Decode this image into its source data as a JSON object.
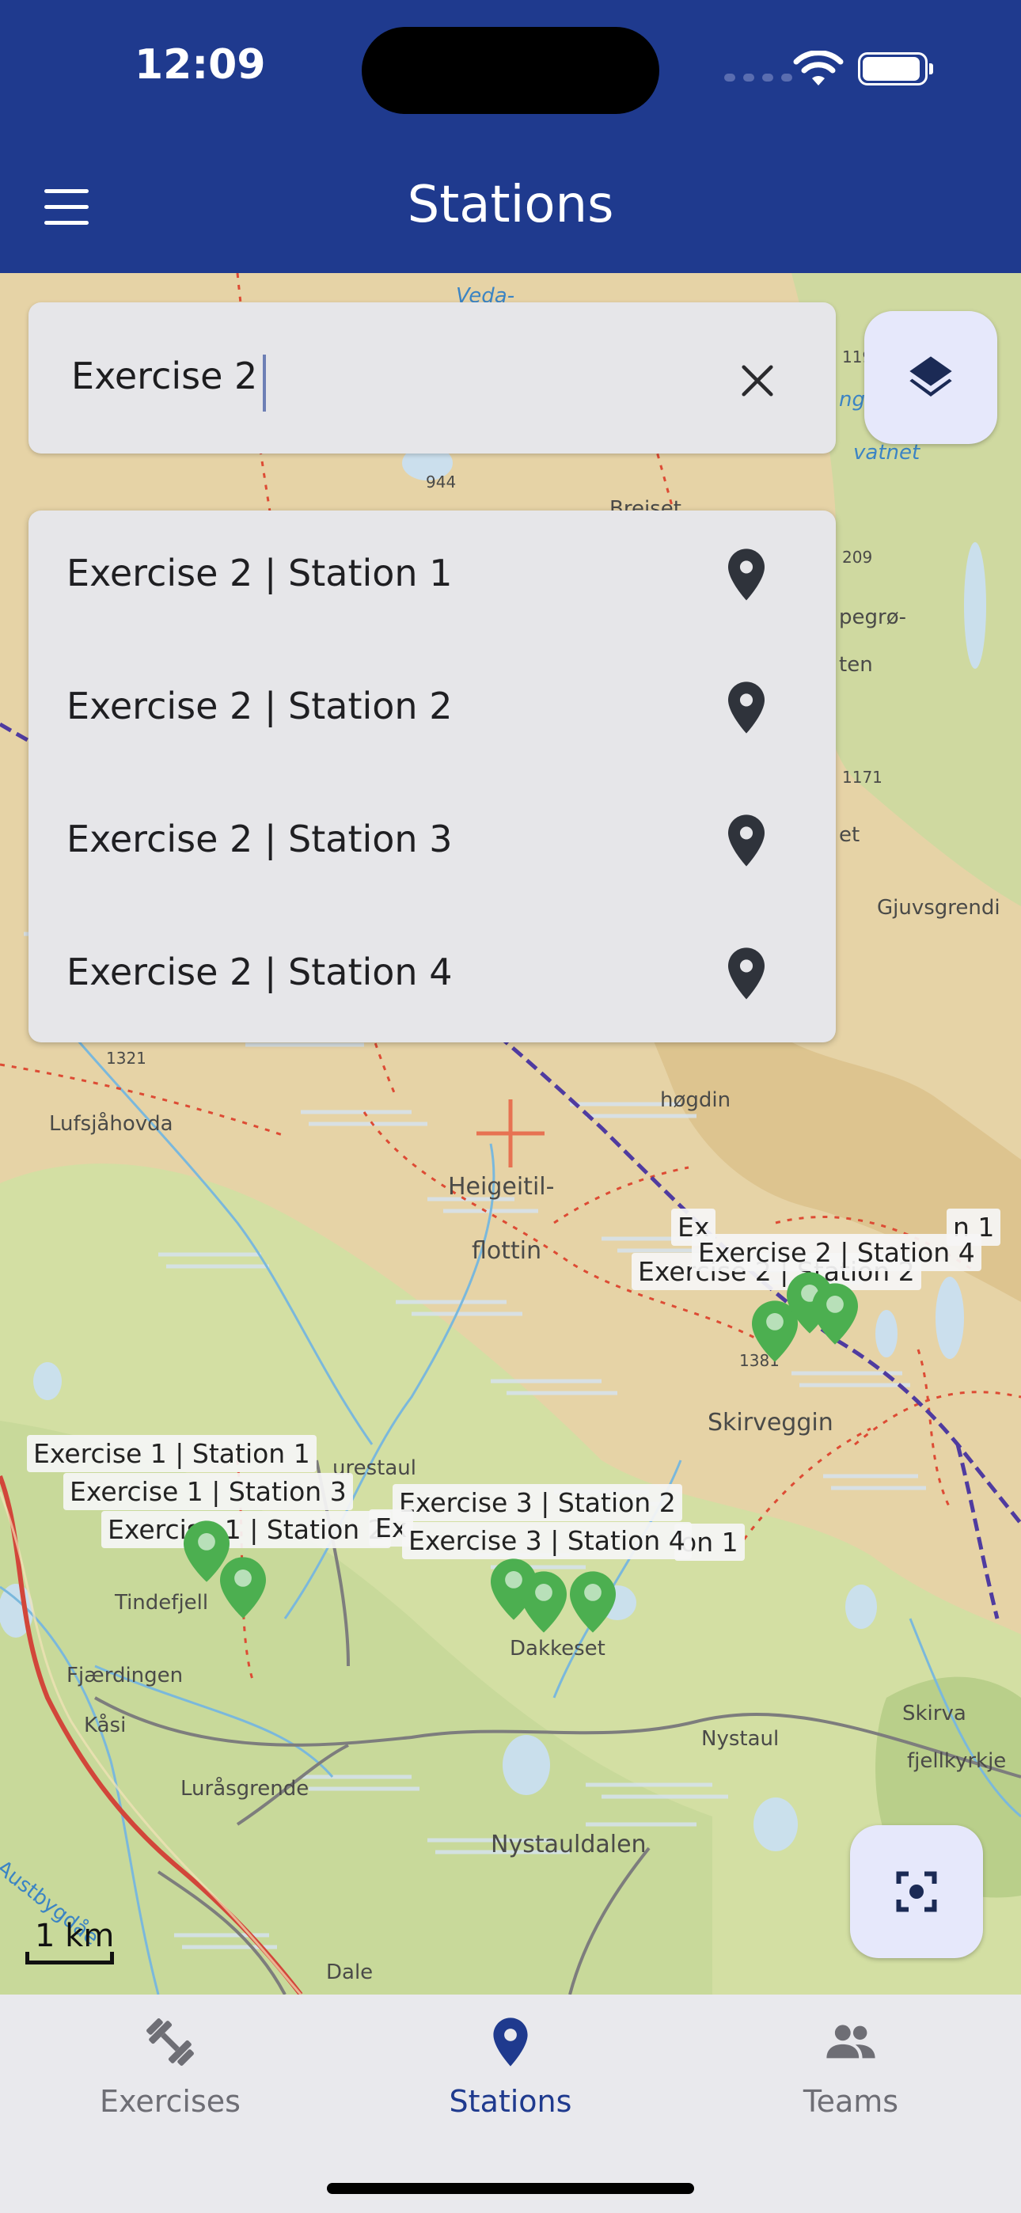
{
  "status_bar": {
    "time": "12:09"
  },
  "app_bar": {
    "title": "Stations",
    "menu_icon": "hamburger-menu-icon"
  },
  "search": {
    "value": "Exercise 2",
    "clear_icon": "close-icon"
  },
  "suggestions": [
    {
      "label": "Exercise 2 | Station 1",
      "icon": "location-pin-icon"
    },
    {
      "label": "Exercise 2 | Station 2",
      "icon": "location-pin-icon"
    },
    {
      "label": "Exercise 2 | Station 3",
      "icon": "location-pin-icon"
    },
    {
      "label": "Exercise 2 | Station 4",
      "icon": "location-pin-icon"
    }
  ],
  "map": {
    "place_names": {
      "gjuvsgrendi": "Gjuvsgrendi",
      "lufsjahovda": "Lufsjåhovda",
      "hogdin": "høgdin",
      "heigeitil": "Heigeitil-",
      "flottin": "flottin",
      "skirveggin": "Skirveggin",
      "tindefjell": "Tindefjell",
      "fjaerdingen": "Fjærdingen",
      "kasi": "Kåsi",
      "lurasgrende": "Luråsgrende",
      "austbygdae": "Austbygdåe",
      "nystauldalen": "Nystauldalen",
      "nystaul": "Nystaul",
      "dakkeset": "Dakkeset",
      "skirva": "Skirva",
      "fjellkyrkje": "fjellkyrkje",
      "dale": "Dale",
      "lurestaul": "urestaul",
      "elev_1321": "1321",
      "elev_1381": "1381",
      "elev_1171": "1171",
      "elev_209": "209",
      "elev_944": "944",
      "elev_119": "119",
      "pegro": "pegrø-",
      "ten": "ten",
      "et": "et",
      "vatnet": "vatnet",
      "veda": "Veda-",
      "brei": "Breiset",
      "nge": "nge"
    },
    "marker_labels": {
      "e1s1": "Exercise 1 | Station 1",
      "e1s3": "Exercise 1 | Station 3",
      "e1s2": "Exercise 1 | Station 2",
      "e3s2": "Exercise 3 | Station 2",
      "e3s4": "Exercise 3 | Station 4",
      "e3s1_partial": "on 1",
      "e3_partial": "Ex",
      "e2s4": "Exercise 2 | Station 4",
      "e2s2": "Exercise 2 | Station 2",
      "e2s3_partial": "Ex",
      "e2s1_partial": "n 1"
    },
    "marker_color": "#4caf50",
    "crosshair_color": "#e8684a"
  },
  "scale": {
    "label": "1 km"
  },
  "layers_icon": "layers-icon",
  "locate_icon": "center-focus-icon",
  "bottom_nav": {
    "items": [
      {
        "label": "Exercises",
        "icon": "dumbbell-icon"
      },
      {
        "label": "Stations",
        "icon": "location-pin-icon"
      },
      {
        "label": "Teams",
        "icon": "people-icon"
      }
    ],
    "active_color": "#1f3a8e",
    "inactive_color": "#6e6e75"
  }
}
